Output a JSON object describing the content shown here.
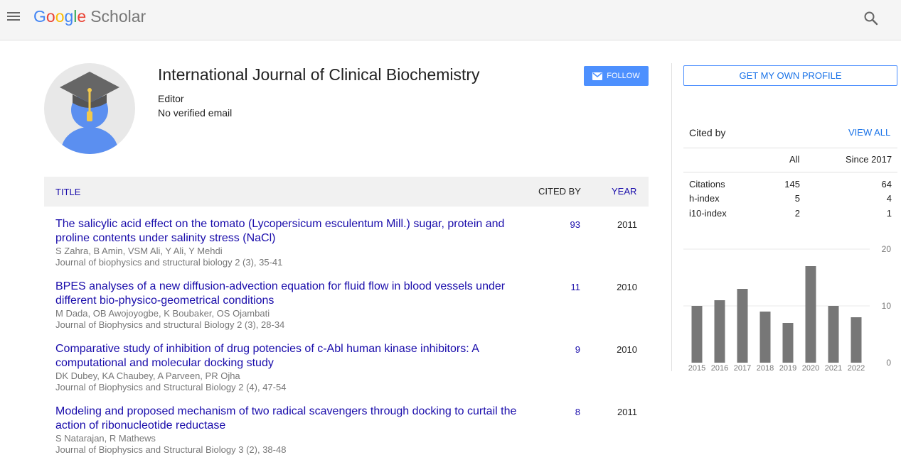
{
  "header": {
    "logo_letters": [
      "G",
      "o",
      "o",
      "g",
      "l",
      "e"
    ],
    "logo_suffix": "Scholar",
    "menu_icon": "hamburger-menu-icon",
    "search_icon": "search-icon"
  },
  "profile": {
    "name": "International Journal of Clinical Biochemistry",
    "affiliation": "Editor",
    "email": "No verified email",
    "follow_label": "FOLLOW",
    "avatar_icon": "graduate-avatar-icon"
  },
  "table": {
    "headers": {
      "title": "TITLE",
      "cited_by": "CITED BY",
      "year": "YEAR"
    },
    "rows": [
      {
        "title": "The salicylic acid effect on the tomato (Lycopersicum esculentum Mill.) sugar, protein and proline contents under salinity stress (NaCl)",
        "authors": "S Zahra, B Amin, VSM Ali, Y Ali, Y Mehdi",
        "venue": "Journal of biophysics and structural biology 2 (3), 35-41",
        "cited_by": "93",
        "year": "2011"
      },
      {
        "title": "BPES analyses of a new diffusion-advection equation for fluid flow in blood vessels under different bio-physico-geometrical conditions",
        "authors": "M Dada, OB Awojoyogbe, K Boubaker, OS Ojambati",
        "venue": "Journal of Biophysics and structural Biology 2 (3), 28-34",
        "cited_by": "11",
        "year": "2010"
      },
      {
        "title": "Comparative study of inhibition of drug potencies of c-Abl human kinase inhibitors: A computational and molecular docking study",
        "authors": "DK Dubey, KA Chaubey, A Parveen, PR Ojha",
        "venue": "Journal of Biophysics and Structural Biology 2 (4), 47-54",
        "cited_by": "9",
        "year": "2010"
      },
      {
        "title": "Modeling and proposed mechanism of two radical scavengers through docking to curtail the action of ribonucleotide reductase",
        "authors": "S Natarajan, R Mathews",
        "venue": "Journal of Biophysics and Structural Biology 3 (2), 38-48",
        "cited_by": "8",
        "year": "2011"
      }
    ]
  },
  "sidebar": {
    "get_profile_label": "GET MY OWN PROFILE",
    "cited_by_label": "Cited by",
    "view_all_label": "VIEW ALL",
    "col_all": "All",
    "col_since": "Since 2017",
    "stats": [
      {
        "label": "Citations",
        "all": "145",
        "since": "64"
      },
      {
        "label": "h-index",
        "all": "5",
        "since": "4"
      },
      {
        "label": "i10-index",
        "all": "2",
        "since": "1"
      }
    ]
  },
  "colors": {
    "link": "#1a0dab",
    "accent": "#4d90fe",
    "bar": "#777777"
  },
  "chart_data": {
    "type": "bar",
    "categories": [
      "2015",
      "2016",
      "2017",
      "2018",
      "2019",
      "2020",
      "2021",
      "2022"
    ],
    "values": [
      10,
      11,
      13,
      9,
      7,
      17,
      10,
      8
    ],
    "ylim": [
      0,
      20
    ],
    "yticks": [
      "0",
      "10",
      "20"
    ],
    "grid": true
  }
}
